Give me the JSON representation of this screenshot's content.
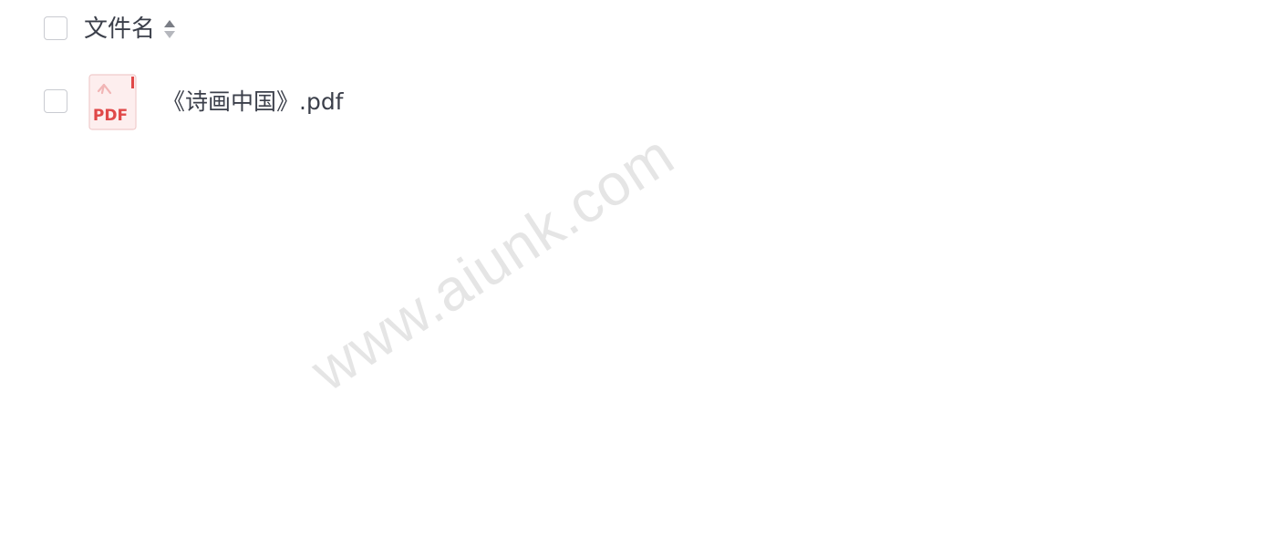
{
  "header": {
    "column_label": "文件名",
    "sort_icon": "sort-updown-icon"
  },
  "files": [
    {
      "name": "《诗画中国》.pdf",
      "type_icon": "pdf-file-icon",
      "icon_label": "PDF",
      "checked": false
    }
  ],
  "watermark": "www.aiunk.com",
  "colors": {
    "text": "#3b3f4a",
    "checkbox_border": "#c9cbd1",
    "pdf_red": "#e04848",
    "pdf_bg": "#fdeeee"
  }
}
